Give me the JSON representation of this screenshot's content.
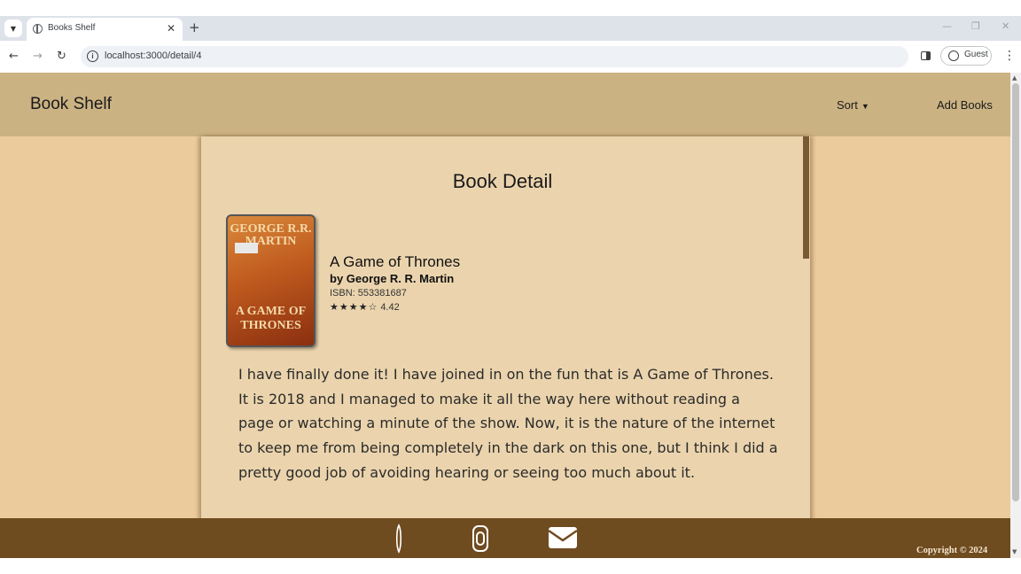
{
  "browser": {
    "tab_title": "Books Shelf",
    "tab_close": "✕",
    "new_tab": "+",
    "url": "localhost:3000/detail/4",
    "profile_label": "Guest",
    "window_controls": [
      "—",
      "❐",
      "✕"
    ]
  },
  "header": {
    "brand": "Book Shelf",
    "nav": {
      "sort_label": "Sort",
      "add_books_label": "Add Books"
    }
  },
  "detail": {
    "page_title": "Book Detail",
    "book": {
      "title": "A Game of Thrones",
      "author": "by George R. R. Martin",
      "isbn": "ISBN: 553381687",
      "stars": "★★★★☆",
      "rating": "4.42",
      "cover_author": "GEORGE R.R. MARTIN",
      "cover_title": "A GAME OF THRONES"
    },
    "review": "I have finally done it! I have joined in on the fun that is A Game of Thrones. It is 2018 and I managed to make it all the way here without reading a page or watching a minute of the show. Now, it is the nature of the internet to keep me from being completely in the dark on this one, but I think I did a pretty good job of avoiding hearing or seeing too much about it."
  },
  "footer": {
    "icons": [
      "linkedin-icon",
      "instagram-icon",
      "mail-icon"
    ],
    "copyright": "Copyright © 2024"
  },
  "colors": {
    "header_bg": "#cbb283",
    "page_bg": "#ebca9c",
    "panel_bg": "#ebd4ad",
    "footer_bg": "#6f4b20"
  }
}
